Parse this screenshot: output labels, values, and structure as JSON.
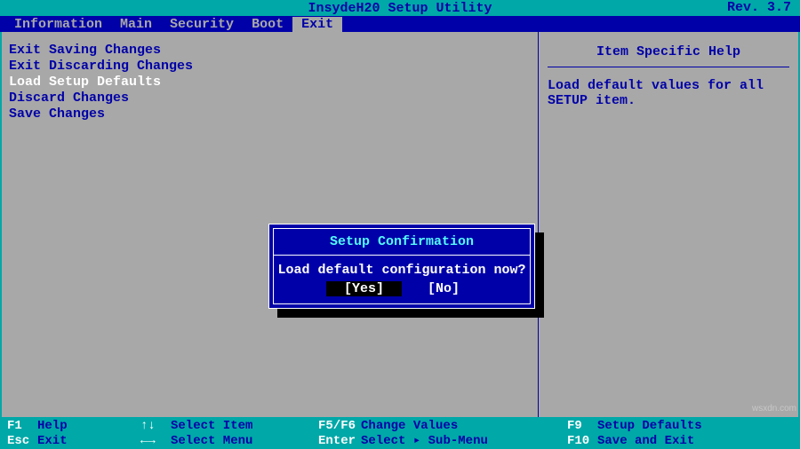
{
  "title": "InsydeH20 Setup Utility",
  "revision": "Rev. 3.7",
  "tabs": [
    {
      "label": "Information",
      "active": false
    },
    {
      "label": "Main",
      "active": false
    },
    {
      "label": "Security",
      "active": false
    },
    {
      "label": "Boot",
      "active": false
    },
    {
      "label": "Exit",
      "active": true
    }
  ],
  "exit_menu": [
    {
      "label": "Exit Saving Changes",
      "selected": false
    },
    {
      "label": "Exit Discarding Changes",
      "selected": false
    },
    {
      "label": "Load Setup Defaults",
      "selected": true
    },
    {
      "label": "Discard Changes",
      "selected": false
    },
    {
      "label": "Save Changes",
      "selected": false
    }
  ],
  "help": {
    "title": "Item Specific Help",
    "body": "Load default values for all SETUP item."
  },
  "dialog": {
    "title": "Setup Confirmation",
    "message": "Load default configuration now?",
    "yes": "[Yes]",
    "no": "[No]"
  },
  "footer": {
    "f1": "F1",
    "f1_label": "Help",
    "esc": "Esc",
    "esc_label": "Exit",
    "updown": "↑↓",
    "updown_label": "Select Item",
    "leftright": "←→",
    "leftright_label": "Select Menu",
    "f5f6": "F5/F6",
    "f5f6_label": "Change Values",
    "enter": "Enter",
    "enter_label": "Select ▸ Sub-Menu",
    "f9": "F9",
    "f9_label": "Setup Defaults",
    "f10": "F10",
    "f10_label": "Save and Exit"
  },
  "credit": "wsxdn.com"
}
